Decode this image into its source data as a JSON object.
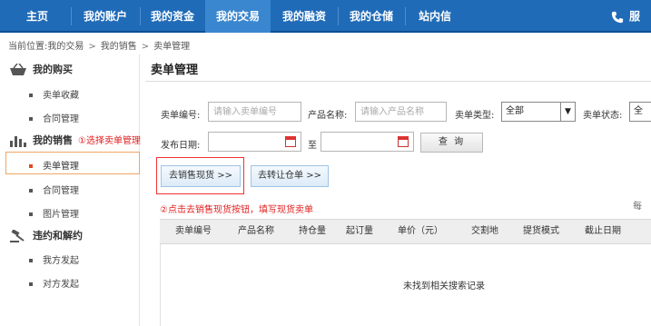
{
  "nav": {
    "items": [
      {
        "label": "主页"
      },
      {
        "label": "我的账户"
      },
      {
        "label": "我的资金"
      },
      {
        "label": "我的交易"
      },
      {
        "label": "我的融资"
      },
      {
        "label": "我的仓储"
      },
      {
        "label": "站内信"
      }
    ],
    "active_index": 3,
    "service_label": "服",
    "icon": "phone-icon"
  },
  "breadcrumb": {
    "prefix": "当前位置:",
    "items": [
      "我的交易",
      "我的销售",
      "卖单管理"
    ],
    "separator": ">"
  },
  "sidebar": {
    "groups": [
      {
        "label": "我的购买",
        "icon": "basket-icon",
        "items": [
          "卖单收藏",
          "合同管理"
        ]
      },
      {
        "label": "我的销售",
        "icon": "bar-chart-icon",
        "annotation": "①选择卖单管理",
        "items": [
          "卖单管理",
          "合同管理",
          "图片管理"
        ],
        "active_item": "卖单管理"
      },
      {
        "label": "违约和解约",
        "icon": "gavel-icon",
        "items": [
          "我方发起",
          "对方发起"
        ]
      }
    ]
  },
  "main": {
    "title": "卖单管理",
    "filters": {
      "order_no_label": "卖单编号:",
      "order_no_placeholder": "请输入卖单编号",
      "product_label": "产品名称:",
      "product_placeholder": "请输入产品名称",
      "type_label": "卖单类型:",
      "type_value": "全部",
      "status_label": "卖单状态:",
      "status_value": "全",
      "date_label": "发布日期:",
      "date_sep": "至",
      "search_button": "查 询"
    },
    "actions": {
      "go_sell_spot": "去销售现货 >>",
      "go_transfer_warehouse": "去转让仓单 >>"
    },
    "annotation_step2": "②点击去销售现货按钮，填写现货卖单",
    "per_page": "每",
    "table": {
      "columns": [
        "卖单编号",
        "产品名称",
        "持仓量",
        "起订量",
        "单价（元）",
        "交割地",
        "提货模式",
        "截止日期"
      ],
      "empty_text": "未找到相关搜索记录"
    }
  },
  "colors": {
    "nav_bg": "#1f6bb8",
    "nav_active": "#3a86cf",
    "annotation": "#e02020",
    "active_border": "#f0a565"
  }
}
